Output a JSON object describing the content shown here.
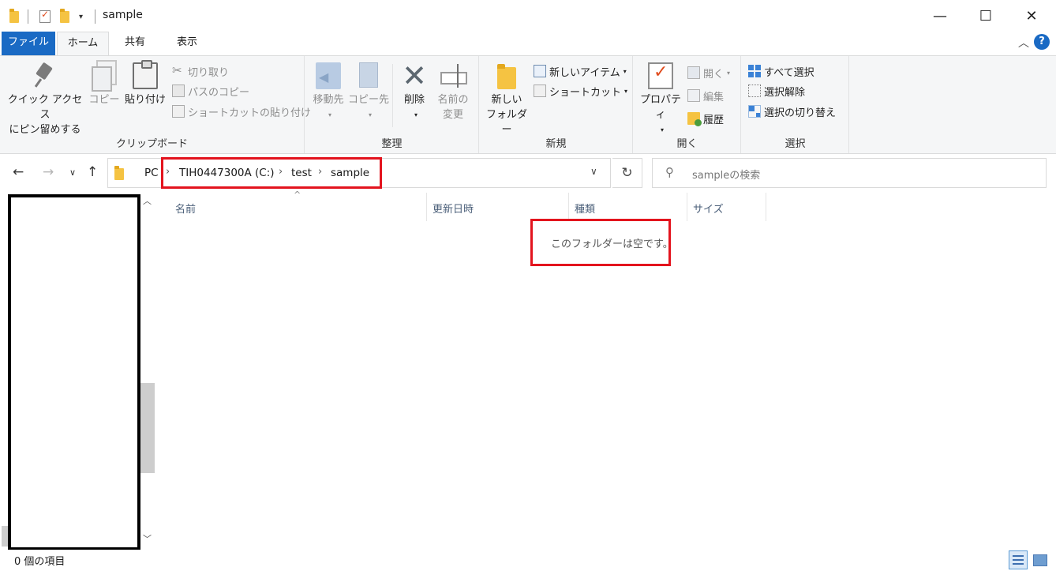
{
  "window": {
    "title": "sample",
    "minimize": "—",
    "maximize": "☐",
    "close": "✕"
  },
  "tabs": {
    "file": "ファイル",
    "home": "ホーム",
    "share": "共有",
    "view": "表示"
  },
  "ribbon": {
    "clipboard": {
      "label": "クリップボード",
      "pin_line1": "クイック アクセス",
      "pin_line2": "にピン留めする",
      "copy": "コピー",
      "paste": "貼り付け",
      "cut": "切り取り",
      "copy_path": "パスのコピー",
      "paste_shortcut": "ショートカットの貼り付け"
    },
    "organize": {
      "label": "整理",
      "move_to": "移動先",
      "copy_to": "コピー先",
      "delete": "削除",
      "rename_line1": "名前の",
      "rename_line2": "変更"
    },
    "new": {
      "label": "新規",
      "new_folder_line1": "新しい",
      "new_folder_line2": "フォルダー",
      "new_item": "新しいアイテム",
      "shortcut": "ショートカット"
    },
    "open": {
      "label": "開く",
      "properties": "プロパティ",
      "open": "開く",
      "edit": "編集",
      "history": "履歴"
    },
    "select": {
      "label": "選択",
      "select_all": "すべて選択",
      "select_none": "選択解除",
      "invert": "選択の切り替え"
    }
  },
  "address": {
    "crumbs": [
      "PC",
      "TIH0447300A (C:)",
      "test",
      "sample"
    ],
    "search_placeholder": "sampleの検索"
  },
  "columns": {
    "name": "名前",
    "modified": "更新日時",
    "type": "種類",
    "size": "サイズ"
  },
  "content": {
    "empty_message": "このフォルダーは空です。"
  },
  "status": {
    "item_count": "0 個の項目"
  },
  "colors": {
    "accent": "#1a6ac4",
    "highlight_box": "#e3141e",
    "ribbon_bg": "#f5f6f7"
  }
}
